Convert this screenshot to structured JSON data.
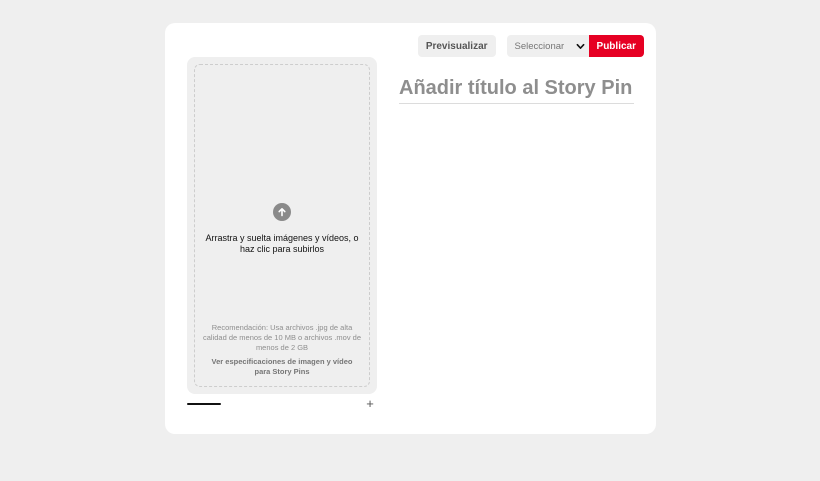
{
  "toolbar": {
    "preview_label": "Previsualizar",
    "board_select": {
      "selected": "Seleccionar",
      "options": [
        "Seleccionar"
      ]
    },
    "publish_label": "Publicar"
  },
  "upload": {
    "icon": "arrow-up-circle-icon",
    "instruction": "Arrastra y suelta imágenes y vídeos, o haz clic para subirlos",
    "recommendation": "Recomendación: Usa archivos .jpg de alta calidad de menos de 10 MB o archivos .mov de menos de 2 GB",
    "specs_link": "Ver especificaciones de imagen y vídeo para Story Pins"
  },
  "pages": {
    "add_symbol": "+"
  },
  "title": {
    "placeholder": "Añadir título al Story Pin",
    "value": ""
  },
  "colors": {
    "accent": "#e60023",
    "background": "#efefef",
    "card": "#ffffff"
  }
}
